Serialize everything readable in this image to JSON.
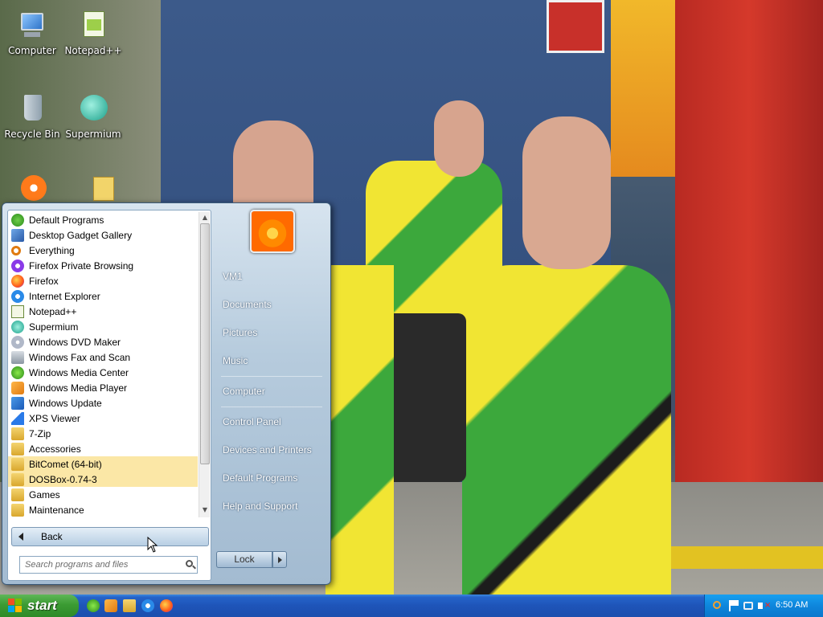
{
  "desktop": {
    "icons": [
      {
        "label": "Computer"
      },
      {
        "label": "Notepad++"
      },
      {
        "label": "Recycle Bin"
      },
      {
        "label": "Supermium"
      }
    ]
  },
  "start_menu": {
    "programs": [
      {
        "label": "Default Programs",
        "icon": "default-programs-icon"
      },
      {
        "label": "Desktop Gadget Gallery",
        "icon": "gadget-icon"
      },
      {
        "label": "Everything",
        "icon": "search-icon"
      },
      {
        "label": "Firefox Private Browsing",
        "icon": "firefox-private-icon"
      },
      {
        "label": "Firefox",
        "icon": "firefox-icon"
      },
      {
        "label": "Internet Explorer",
        "icon": "ie-icon"
      },
      {
        "label": "Notepad++",
        "icon": "notepad-icon"
      },
      {
        "label": "Supermium",
        "icon": "supermium-icon"
      },
      {
        "label": "Windows DVD Maker",
        "icon": "dvd-icon"
      },
      {
        "label": "Windows Fax and Scan",
        "icon": "fax-icon"
      },
      {
        "label": "Windows Media Center",
        "icon": "media-center-icon"
      },
      {
        "label": "Windows Media Player",
        "icon": "media-player-icon"
      },
      {
        "label": "Windows Update",
        "icon": "update-icon"
      },
      {
        "label": "XPS Viewer",
        "icon": "xps-icon"
      },
      {
        "label": "7-Zip",
        "icon": "folder-icon"
      },
      {
        "label": "Accessories",
        "icon": "folder-icon"
      },
      {
        "label": "BitComet (64-bit)",
        "icon": "folder-icon"
      },
      {
        "label": "DOSBox-0.74-3",
        "icon": "folder-icon"
      },
      {
        "label": "Games",
        "icon": "folder-icon"
      },
      {
        "label": "Maintenance",
        "icon": "folder-icon"
      }
    ],
    "back_label": "Back",
    "search_placeholder": "Search programs and files",
    "right_items": {
      "user": "VM1",
      "documents": "Documents",
      "pictures": "Pictures",
      "music": "Music",
      "computer": "Computer",
      "control_panel": "Control Panel",
      "devices": "Devices and Printers",
      "default_programs": "Default Programs",
      "help": "Help and Support"
    },
    "lock_label": "Lock"
  },
  "taskbar": {
    "start_label": "start",
    "clock": "6:50 AM"
  },
  "colors": {
    "highlight": "#fbe7a6",
    "taskbar": "#1e54b8",
    "start_green": "#3b9b33",
    "tray": "#0e86dc"
  }
}
